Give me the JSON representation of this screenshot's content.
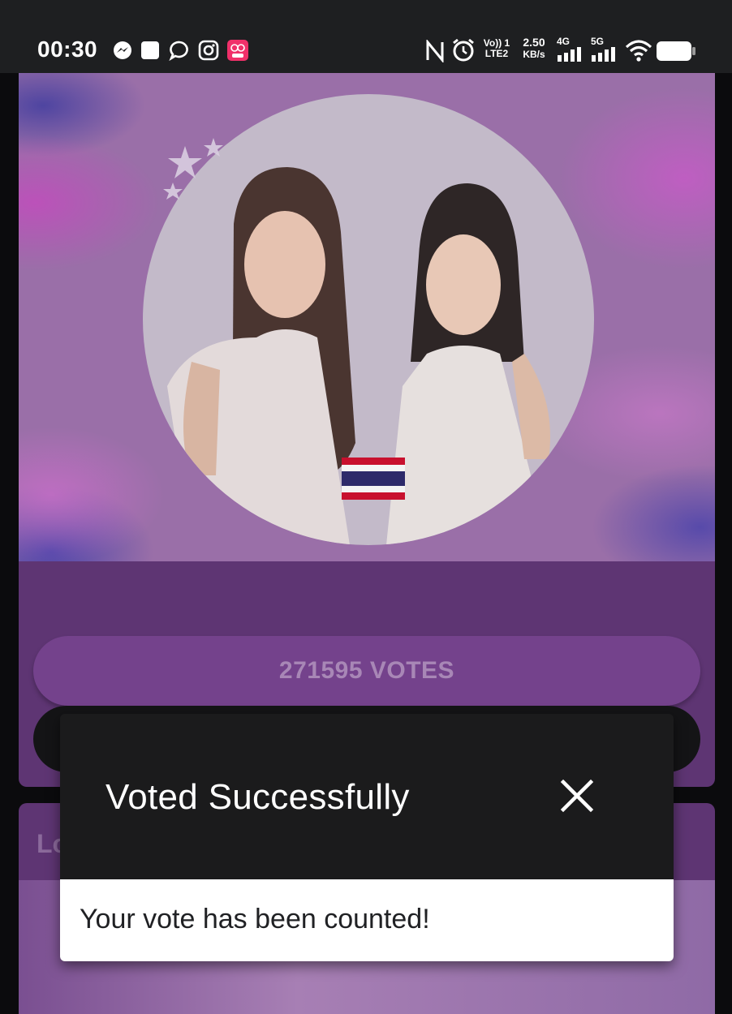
{
  "status_bar": {
    "time": "00:30",
    "left_icons": [
      "messenger-icon",
      "square-icon",
      "chat-bubble-icon",
      "instagram-icon",
      "lazada-icon"
    ],
    "volte_top": "Vo)) 1",
    "volte_bottom": "LTE2",
    "speed_value": "2.50",
    "speed_unit": "KB/s",
    "net1": "4G",
    "net2": "5G",
    "right_icons": [
      "nfc-icon",
      "alarm-icon",
      "wifi-icon",
      "battery-icon"
    ]
  },
  "card": {
    "votes_label": "271595 VOTES"
  },
  "second_card": {
    "title_partial": "Lo"
  },
  "toast": {
    "title": "Voted Successfully",
    "message": "Your vote has been counted!"
  },
  "colors": {
    "card_bg": "#5e3573",
    "toast_bg": "#1b1b1c",
    "status_bar_bg": "#1e1f21"
  }
}
